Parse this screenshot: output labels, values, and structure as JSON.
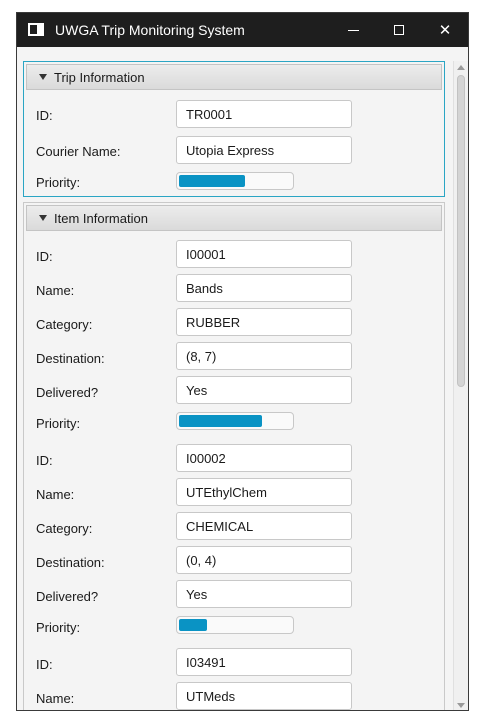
{
  "window": {
    "title": "UWGA Trip Monitoring System"
  },
  "trip": {
    "header": "Trip Information",
    "id_label": "ID:",
    "id_value": "TR0001",
    "courier_label": "Courier Name:",
    "courier_value": "Utopia Express",
    "priority_label": "Priority:",
    "priority_progress": 0.6
  },
  "items_section": {
    "header": "Item Information",
    "labels": {
      "id": "ID:",
      "name": "Name:",
      "category": "Category:",
      "destination": "Destination:",
      "delivered": "Delivered?",
      "priority": "Priority:"
    },
    "items": [
      {
        "id": "I00001",
        "name": "Bands",
        "category": "RUBBER",
        "destination": "(8, 7)",
        "delivered": "Yes",
        "priority_progress": 0.75
      },
      {
        "id": "I00002",
        "name": "UTEthylChem",
        "category": "CHEMICAL",
        "destination": "(0, 4)",
        "delivered": "Yes",
        "priority_progress": 0.25
      },
      {
        "id": "I03491",
        "name": "UTMeds"
      }
    ]
  },
  "colors": {
    "accent": "#0a93c4",
    "focus_border": "#2aa5c4",
    "titlebar": "#1e1e1e"
  },
  "icons": {
    "app": "window-app-icon",
    "minimize": "minimize-icon",
    "maximize": "maximize-icon",
    "close": "close-icon"
  }
}
